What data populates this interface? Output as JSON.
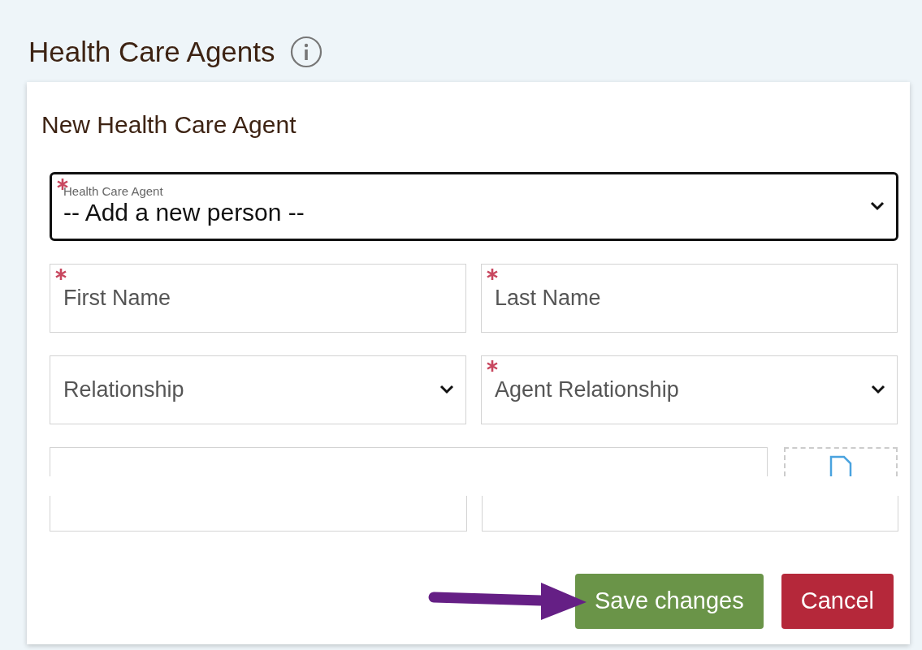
{
  "page": {
    "title": "Health Care Agents"
  },
  "dialog": {
    "title": "New Health Care Agent",
    "agent_select": {
      "label": "Health Care Agent",
      "value": "-- Add a new person --",
      "required": true,
      "focused": true
    },
    "fields": [
      {
        "kind": "text",
        "placeholder": "First Name",
        "required": true
      },
      {
        "kind": "text",
        "placeholder": "Last Name",
        "required": true
      },
      {
        "kind": "select",
        "placeholder": "Relationship",
        "required": false
      },
      {
        "kind": "select",
        "placeholder": "Agent Relationship",
        "required": true
      }
    ],
    "buttons": [
      {
        "label": "Save changes",
        "kind": "primary",
        "highlighted": true
      },
      {
        "label": "Cancel",
        "kind": "danger",
        "highlighted": false
      }
    ]
  }
}
